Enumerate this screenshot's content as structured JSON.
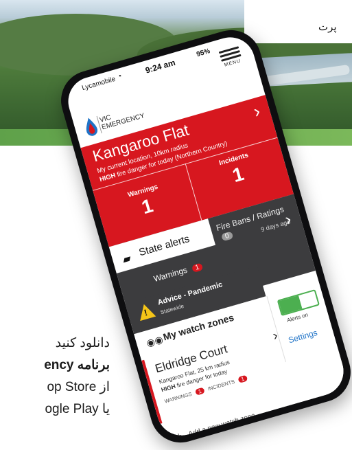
{
  "caption": {
    "text": "پرت"
  },
  "promo": {
    "line1": "دانلود کنید",
    "line2_bold": "برنامه ency",
    "line3": "از op Store",
    "line4": "یا ogle Play"
  },
  "phone": {
    "status": {
      "carrier": "Lycamobile",
      "time": "9:24 am",
      "battery": "95%"
    },
    "menu": {
      "label": "MENU"
    },
    "brand": {
      "line1": "VIC",
      "line2": "EMERGENCY"
    },
    "location": {
      "title": "Kangaroo Flat",
      "subtitle": "My current location, 10km radius",
      "fire_danger_level": "HIGH",
      "fire_danger_text": "fire danger for today (Northern Country)",
      "warnings_label": "Warnings",
      "warnings_count": "1",
      "incidents_label": "Incidents",
      "incidents_count": "1"
    },
    "state_alerts": {
      "title": "State alerts",
      "fire_bans_label": "Fire Bans / Ratings",
      "fire_bans_count": "0",
      "fire_bans_age": "9 days ago",
      "warnings_label": "Warnings",
      "warnings_count": "1",
      "advice_title": "Advice - Pandemic",
      "advice_scope": "Statewide"
    },
    "watch_zones": {
      "title": "My watch zones",
      "alerts_on_label": "Alerts on",
      "alerts_on_value": 1,
      "settings_label": "Settings",
      "zone_name": "Eldridge Court",
      "zone_sub": "Kangaroo Flat, 25 km radius",
      "zone_danger_level": "HIGH",
      "zone_danger_text": "fire danger for today",
      "zone_warnings_label": "WARNINGS",
      "zone_warnings_count": "1",
      "zone_incidents_label": "INCIDENTS",
      "zone_incidents_count": "1",
      "add_zone_label": "Add a new watch zone"
    },
    "colors": {
      "red": "#d7171f",
      "dark": "#3c3c3e",
      "toggle": "#4caf50",
      "link": "#1f73c7",
      "warning": "#f5c518"
    }
  }
}
